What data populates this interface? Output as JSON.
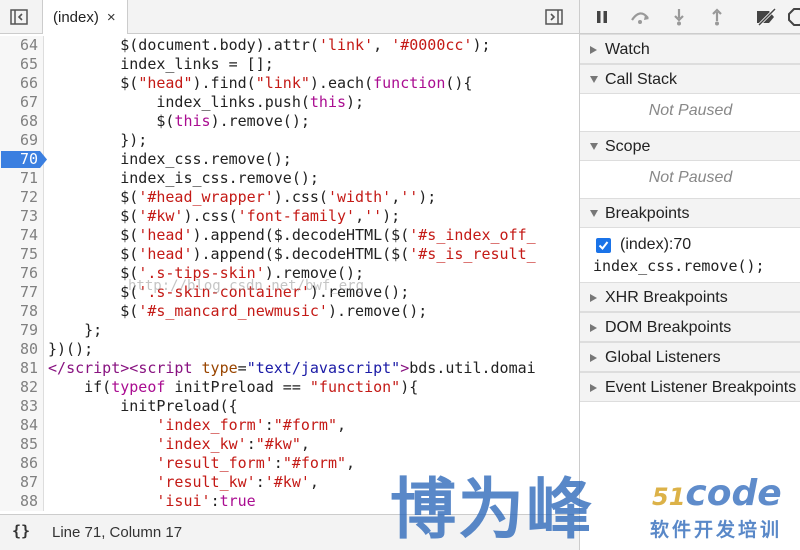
{
  "editor": {
    "tab_label": "(index)",
    "tab_close": "×",
    "breakpoint_line": 70,
    "lines": [
      {
        "n": "64",
        "t": [
          [
            "        $(document.body).attr(",
            ""
          ],
          [
            "'link'",
            "s"
          ],
          [
            ", ",
            ""
          ],
          [
            "'#0000cc'",
            "s"
          ],
          [
            ");",
            ""
          ]
        ]
      },
      {
        "n": "65",
        "t": [
          [
            "        index_links = [];",
            ""
          ]
        ]
      },
      {
        "n": "66",
        "t": [
          [
            "        $(",
            ""
          ],
          [
            "\"head\"",
            "s"
          ],
          [
            ").find(",
            ""
          ],
          [
            "\"link\"",
            "s"
          ],
          [
            ").each(",
            ""
          ],
          [
            "function",
            "k"
          ],
          [
            "(){",
            ""
          ]
        ]
      },
      {
        "n": "67",
        "t": [
          [
            "            index_links.push(",
            ""
          ],
          [
            "this",
            "k"
          ],
          [
            ");",
            ""
          ]
        ]
      },
      {
        "n": "68",
        "t": [
          [
            "            $(",
            ""
          ],
          [
            "this",
            "k"
          ],
          [
            ").remove();",
            ""
          ]
        ]
      },
      {
        "n": "69",
        "t": [
          [
            "        });",
            ""
          ]
        ]
      },
      {
        "n": "70",
        "t": [
          [
            "        index_css.remove();",
            ""
          ]
        ]
      },
      {
        "n": "71",
        "t": [
          [
            "        index_is_css.remove();",
            ""
          ]
        ]
      },
      {
        "n": "72",
        "t": [
          [
            "        $(",
            ""
          ],
          [
            "'#head_wrapper'",
            "s"
          ],
          [
            ").css(",
            ""
          ],
          [
            "'width'",
            "s"
          ],
          [
            ",",
            ""
          ],
          [
            "''",
            "s"
          ],
          [
            ");",
            ""
          ]
        ]
      },
      {
        "n": "73",
        "t": [
          [
            "        $(",
            ""
          ],
          [
            "'#kw'",
            "s"
          ],
          [
            ").css(",
            ""
          ],
          [
            "'font-family'",
            "s"
          ],
          [
            ",",
            ""
          ],
          [
            "''",
            "s"
          ],
          [
            ");",
            ""
          ]
        ]
      },
      {
        "n": "74",
        "t": [
          [
            "        $(",
            ""
          ],
          [
            "'head'",
            "s"
          ],
          [
            ").append($.decodeHTML($(",
            ""
          ],
          [
            "'#s_index_off_",
            "s"
          ]
        ]
      },
      {
        "n": "75",
        "t": [
          [
            "        $(",
            ""
          ],
          [
            "'head'",
            "s"
          ],
          [
            ").append($.decodeHTML($(",
            ""
          ],
          [
            "'#s_is_result_",
            "s"
          ]
        ]
      },
      {
        "n": "76",
        "t": [
          [
            "        $(",
            ""
          ],
          [
            "'.s-tips-skin'",
            "s"
          ],
          [
            ").remove();",
            ""
          ]
        ]
      },
      {
        "n": "77",
        "t": [
          [
            "        $(",
            ""
          ],
          [
            "'.s-skin-container'",
            "s"
          ],
          [
            ").remove();",
            ""
          ]
        ]
      },
      {
        "n": "78",
        "t": [
          [
            "        $(",
            ""
          ],
          [
            "'#s_mancard_newmusic'",
            "s"
          ],
          [
            ").remove();",
            ""
          ]
        ]
      },
      {
        "n": "79",
        "t": [
          [
            "    };",
            ""
          ]
        ]
      },
      {
        "n": "80",
        "t": [
          [
            "})();",
            ""
          ]
        ]
      },
      {
        "n": "81",
        "t": [
          [
            "</",
            "g"
          ],
          [
            "script",
            "g"
          ],
          [
            "><",
            "g"
          ],
          [
            "script ",
            "g"
          ],
          [
            "type",
            "a"
          ],
          [
            "=",
            ""
          ],
          [
            "\"text/javascript\"",
            "v"
          ],
          [
            ">",
            "g"
          ],
          [
            "bds.util.domai",
            ""
          ]
        ]
      },
      {
        "n": "82",
        "t": [
          [
            "    if(",
            ""
          ],
          [
            "typeof",
            "k"
          ],
          [
            " initPreload == ",
            ""
          ],
          [
            "\"function\"",
            "s"
          ],
          [
            "){",
            ""
          ]
        ]
      },
      {
        "n": "83",
        "t": [
          [
            "        initPreload({",
            ""
          ]
        ]
      },
      {
        "n": "84",
        "t": [
          [
            "            ",
            ""
          ],
          [
            "'index_form'",
            "s"
          ],
          [
            ":",
            ""
          ],
          [
            "\"#form\"",
            "s"
          ],
          [
            ",",
            ""
          ]
        ]
      },
      {
        "n": "85",
        "t": [
          [
            "            ",
            ""
          ],
          [
            "'index_kw'",
            "s"
          ],
          [
            ":",
            ""
          ],
          [
            "\"#kw\"",
            "s"
          ],
          [
            ",",
            ""
          ]
        ]
      },
      {
        "n": "86",
        "t": [
          [
            "            ",
            ""
          ],
          [
            "'result_form'",
            "s"
          ],
          [
            ":",
            ""
          ],
          [
            "\"#form\"",
            "s"
          ],
          [
            ",",
            ""
          ]
        ]
      },
      {
        "n": "87",
        "t": [
          [
            "            ",
            ""
          ],
          [
            "'result_kw'",
            "s"
          ],
          [
            ":",
            ""
          ],
          [
            "'#kw'",
            "s"
          ],
          [
            ",",
            ""
          ]
        ]
      },
      {
        "n": "88",
        "t": [
          [
            "            ",
            ""
          ],
          [
            "'isui'",
            "s"
          ],
          [
            ":",
            ""
          ],
          [
            "true",
            "k"
          ]
        ]
      }
    ],
    "watermark_url": "http://blog.csdn.net/bwf_erg"
  },
  "status": {
    "format_label": "{}",
    "cursor_text": "Line 71, Column 17"
  },
  "sidebar": {
    "watch_label": "Watch",
    "call_stack_label": "Call Stack",
    "call_stack_placeholder": "Not Paused",
    "scope_label": "Scope",
    "scope_placeholder": "Not Paused",
    "breakpoints_label": "Breakpoints",
    "breakpoint_location": "(index):70",
    "breakpoint_code": "index_css.remove();",
    "breakpoint_checked": true,
    "xhr_label": "XHR Breakpoints",
    "dom_label": "DOM Breakpoints",
    "global_label": "Global Listeners",
    "event_label": "Event Listener Breakpoints"
  },
  "brand": {
    "chinese_name": "博为峰",
    "logo_num": "51",
    "logo_text": "code",
    "tagline": "软件开发培训"
  },
  "colors": {
    "breakpoint": "#3b7fe0",
    "string": "#c41a16",
    "keyword": "#aa0d91",
    "checkbox": "#1a73e8",
    "brand_blue": "#2a66b9"
  }
}
